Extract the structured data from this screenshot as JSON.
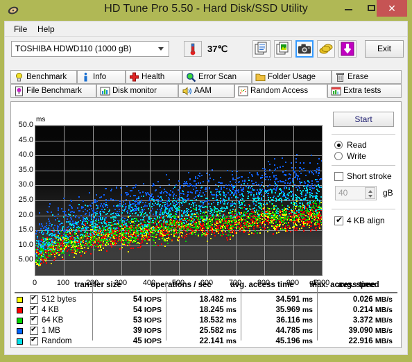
{
  "window": {
    "title": "HD Tune Pro 5.50 - Hard Disk/SSD Utility",
    "icon": "hard-disk-icon",
    "minimize": "–",
    "maximize": "□",
    "close": "✕",
    "titlebar_color": "#b0b855",
    "close_color": "#c65454"
  },
  "menu": {
    "file": "File",
    "help": "Help"
  },
  "toolbar": {
    "drive": "TOSHIBA HDWD110 (1000 gB)",
    "temperature": "37℃",
    "exit": "Exit",
    "buttons": [
      {
        "name": "copy-text-icon"
      },
      {
        "name": "copy-image-icon"
      },
      {
        "name": "screenshot-camera-icon"
      },
      {
        "name": "coins-icon"
      },
      {
        "name": "download-arrow-icon"
      }
    ]
  },
  "tabs": {
    "row1": [
      {
        "label": "Benchmark",
        "icon": "lightbulb-icon",
        "active": false
      },
      {
        "label": "Info",
        "icon": "info-icon",
        "active": false
      },
      {
        "label": "Health",
        "icon": "red-cross-icon",
        "active": false
      },
      {
        "label": "Error Scan",
        "icon": "magnifier-icon",
        "active": false
      },
      {
        "label": "Folder Usage",
        "icon": "folder-icon",
        "active": false
      },
      {
        "label": "Erase",
        "icon": "trash-icon",
        "active": false
      }
    ],
    "row2": [
      {
        "label": "File Benchmark",
        "icon": "file-benchmark-icon",
        "active": false
      },
      {
        "label": "Disk monitor",
        "icon": "bar-chart-icon",
        "active": false
      },
      {
        "label": "AAM",
        "icon": "speaker-icon",
        "active": false
      },
      {
        "label": "Random Access",
        "icon": "scatter-plot-icon",
        "active": true
      },
      {
        "label": "Extra tests",
        "icon": "extra-tests-icon",
        "active": false
      }
    ]
  },
  "panel": {
    "start": "Start",
    "mode_read": "Read",
    "mode_write": "Write",
    "mode_selected": "Read",
    "short_stroke_label": "Short stroke",
    "short_stroke_checked": false,
    "short_stroke_value": "40",
    "short_stroke_unit": "gB",
    "align_label": "4 KB align",
    "align_checked": true
  },
  "chart_data": {
    "type": "scatter",
    "title": "",
    "xlabel": "gB",
    "ylabel": "ms",
    "xlim": [
      0,
      1000
    ],
    "ylim": [
      0,
      50
    ],
    "xticks": [
      "0",
      "100",
      "200",
      "300",
      "400",
      "500",
      "600",
      "700",
      "800",
      "900",
      "1000"
    ],
    "yticks": [
      "50.0",
      "45.0",
      "40.0",
      "35.0",
      "30.0",
      "25.0",
      "20.0",
      "15.0",
      "10.0",
      "5.00"
    ],
    "grid": true,
    "background": "dark-gradient",
    "legend_position": "table-below",
    "series": [
      {
        "name": "512 bytes",
        "color": "#ffff00",
        "points": 900,
        "band_low": 4.5,
        "band_high": 20.0
      },
      {
        "name": "4 KB",
        "color": "#ff0000",
        "points": 900,
        "band_low": 4.5,
        "band_high": 20.0
      },
      {
        "name": "64 KB",
        "color": "#00d400",
        "points": 900,
        "band_low": 5.0,
        "band_high": 21.0
      },
      {
        "name": "1 MB",
        "color": "#1060ff",
        "points": 900,
        "band_low": 9.0,
        "band_high": 33.0
      },
      {
        "name": "Random",
        "color": "#00d8e8",
        "points": 900,
        "band_low": 7.0,
        "band_high": 27.0
      }
    ]
  },
  "table": {
    "headers": [
      "transfer size",
      "operations / sec",
      "avg. access time",
      "max. access time",
      "avg. speed"
    ],
    "rows": [
      {
        "color": "#ffff00",
        "checked": true,
        "label": "512 bytes",
        "ops": "54",
        "ops_unit": "IOPS",
        "avg": "18.482",
        "avg_unit": "ms",
        "max": "34.591",
        "max_unit": "ms",
        "speed": "0.026",
        "speed_unit": "MB/s"
      },
      {
        "color": "#ff0000",
        "checked": true,
        "label": "4 KB",
        "ops": "54",
        "ops_unit": "IOPS",
        "avg": "18.245",
        "avg_unit": "ms",
        "max": "35.969",
        "max_unit": "ms",
        "speed": "0.214",
        "speed_unit": "MB/s"
      },
      {
        "color": "#00d400",
        "checked": true,
        "label": "64 KB",
        "ops": "53",
        "ops_unit": "IOPS",
        "avg": "18.532",
        "avg_unit": "ms",
        "max": "36.116",
        "max_unit": "ms",
        "speed": "3.372",
        "speed_unit": "MB/s"
      },
      {
        "color": "#0066ff",
        "checked": true,
        "label": "1 MB",
        "ops": "39",
        "ops_unit": "IOPS",
        "avg": "25.582",
        "avg_unit": "ms",
        "max": "44.785",
        "max_unit": "ms",
        "speed": "39.090",
        "speed_unit": "MB/s"
      },
      {
        "color": "#00e0e8",
        "checked": true,
        "label": "Random",
        "ops": "45",
        "ops_unit": "IOPS",
        "avg": "22.141",
        "avg_unit": "ms",
        "max": "45.196",
        "max_unit": "ms",
        "speed": "22.916",
        "speed_unit": "MB/s"
      }
    ]
  }
}
